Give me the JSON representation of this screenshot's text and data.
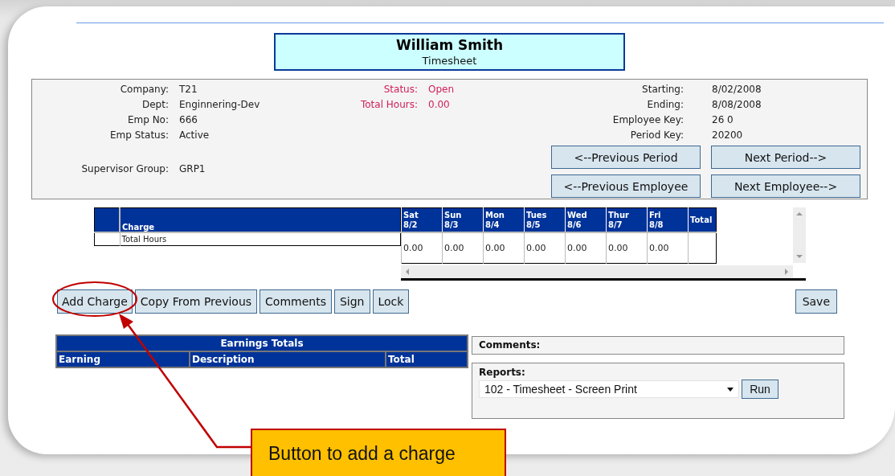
{
  "header": {
    "name": "William Smith",
    "subtitle": "Timesheet"
  },
  "info": {
    "employee": [
      {
        "label": "Company:",
        "value": "T21"
      },
      {
        "label": "Dept:",
        "value": "Enginnering-Dev"
      },
      {
        "label": "Emp No:",
        "value": "666"
      },
      {
        "label": "Emp Status:",
        "value": "Active"
      }
    ],
    "supervisor": {
      "label": "Supervisor Group:",
      "value": "GRP1"
    },
    "status": [
      {
        "label": "Status:",
        "value": "Open"
      },
      {
        "label": "Total Hours:",
        "value": "0.00"
      }
    ],
    "period": [
      {
        "label": "Starting:",
        "value": "8/02/2008"
      },
      {
        "label": "Ending:",
        "value": "8/08/2008"
      },
      {
        "label": "Employee Key:",
        "value": "26 0"
      },
      {
        "label": "Period Key:",
        "value": "20200"
      }
    ],
    "nav_buttons": [
      "<--Previous Period",
      "Next Period-->",
      "<--Previous Employee",
      "Next Employee-->"
    ]
  },
  "charges": {
    "charge_column": "Charge",
    "days": [
      {
        "day": "Sat",
        "date": "8/2"
      },
      {
        "day": "Sun",
        "date": "8/3"
      },
      {
        "day": "Mon",
        "date": "8/4"
      },
      {
        "day": "Tues",
        "date": "8/5"
      },
      {
        "day": "Wed",
        "date": "8/6"
      },
      {
        "day": "Thur",
        "date": "8/7"
      },
      {
        "day": "Fri",
        "date": "8/8"
      }
    ],
    "total_column": "Total",
    "rows": [
      {
        "charge": "Total Hours",
        "values": [
          "0.00",
          "0.00",
          "0.00",
          "0.00",
          "0.00",
          "0.00",
          "0.00"
        ]
      }
    ]
  },
  "actions": [
    "Add Charge",
    "Copy From Previous",
    "Comments",
    "Sign",
    "Lock"
  ],
  "save_button": "Save",
  "earnings": {
    "title": "Earnings Totals",
    "columns": [
      "Earning",
      "Description",
      "Total"
    ]
  },
  "comments": {
    "label": "Comments:"
  },
  "reports": {
    "label": "Reports:",
    "value": "102 - Timesheet - Screen Print",
    "button": "Run"
  },
  "callout": {
    "text": "Button to add a charge"
  }
}
